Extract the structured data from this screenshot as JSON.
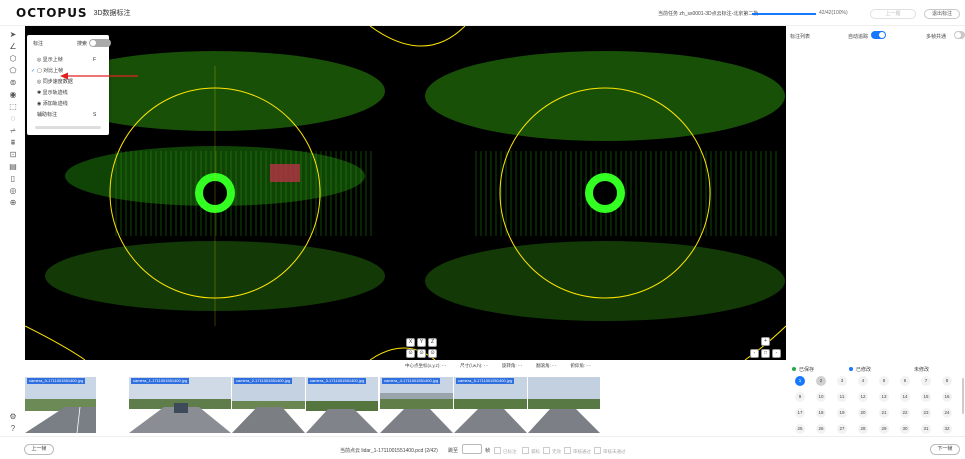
{
  "header": {
    "logo": "OCTOPUS",
    "title": "3D数据标注",
    "task": "当前任务 zh_ss0001-3D点云标注-北京第二批",
    "progress_text": "42/42(100%)",
    "progress_percent": 100,
    "left_button": "上一题",
    "exit_button": "退出标注"
  },
  "float_panel": {
    "head": "标注",
    "search": "搜索",
    "items": [
      {
        "label": "显示上帧",
        "key": "F"
      },
      {
        "label": "对比上帧",
        "key": ""
      },
      {
        "label": "同步速度数据",
        "key": ""
      },
      {
        "label": "显示轨迹线",
        "key": ""
      },
      {
        "label": "添加轨迹线",
        "key": ""
      },
      {
        "label": "辅助标注",
        "key": "S"
      }
    ],
    "check": "✓"
  },
  "view_controls": {
    "r1": [
      "X",
      "Y",
      "Z"
    ],
    "r2": [
      "⊙",
      "⊙",
      "⊙"
    ],
    "right": [
      "+",
      "-",
      "□",
      "-"
    ]
  },
  "infobar": [
    "中心点坐标(x,y,z): - -",
    "尺寸(l,w,h): - -",
    "旋转角: - -",
    "翻滚角: - -",
    "俯仰角: - -"
  ],
  "cameras": [
    {
      "label": "camera_0-1711001551400.jpg"
    },
    {
      "label": "camera_1-1711001551400.jpg"
    },
    {
      "label": "camera_2-1711001551400.jpg"
    },
    {
      "label": "camera_3-1711001551400.jpg"
    },
    {
      "label": "camera_4-1711001551400.jpg"
    },
    {
      "label": "camera_5-1711001551400.jpg"
    }
  ],
  "right_panel": {
    "list_label": "标注列表",
    "auto_label": "自动追踪",
    "auto_on": true,
    "sync_label": "多帧共通",
    "sync_on": false,
    "legend": [
      {
        "label": "已保存",
        "color": "#22aa44"
      },
      {
        "label": "已修改",
        "color": "#1677ff"
      },
      {
        "label": "未修改",
        "color": "#999999"
      }
    ],
    "frames": [
      "1",
      "2",
      "3",
      "4",
      "5",
      "6",
      "7",
      "8",
      "9",
      "10",
      "11",
      "12",
      "13",
      "14",
      "15",
      "16",
      "17",
      "18",
      "19",
      "20",
      "21",
      "22",
      "23",
      "24",
      "25",
      "26",
      "27",
      "28",
      "29",
      "30",
      "31",
      "32"
    ],
    "current_frame": 1,
    "visited_frames": [
      2
    ]
  },
  "footer": {
    "prev": "上一帧",
    "next": "下一帧",
    "current_file": "当前点云 lidar_1-1711001551400.pcd (2/42)",
    "jump_label": "跳至",
    "jump_unit": "帧",
    "checks": [
      "已标注",
      "漏标",
      "无效",
      "审核通过",
      "审核未通过"
    ]
  },
  "colors": {
    "accent": "#1677ff",
    "cloud": "#3cff1a",
    "ring": "#ffe600"
  }
}
